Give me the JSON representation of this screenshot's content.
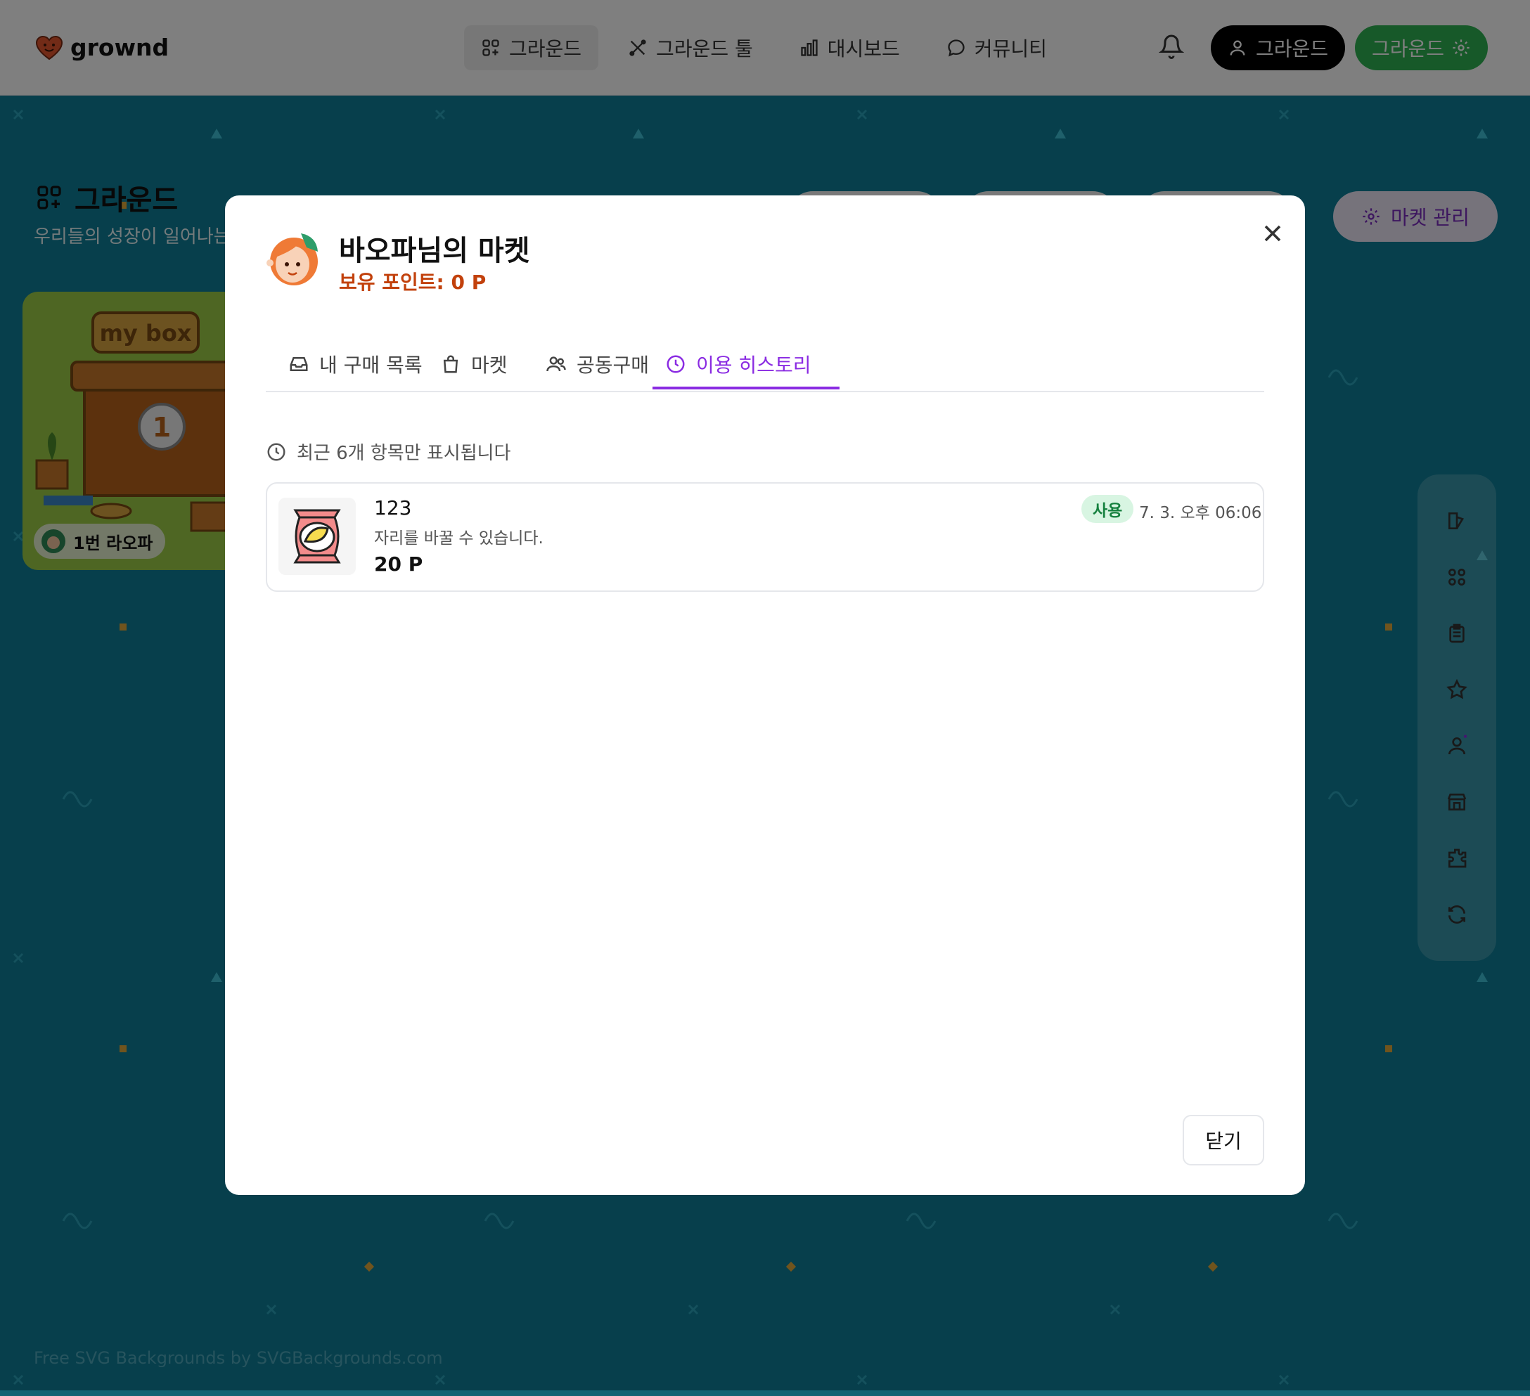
{
  "topbar": {
    "logo": "grownd",
    "nav": [
      {
        "label": "그라운드",
        "icon": "grid-plus-icon",
        "active": true
      },
      {
        "label": "그라운드 툴",
        "icon": "tools-icon",
        "active": false
      },
      {
        "label": "대시보드",
        "icon": "bar-chart-icon",
        "active": false
      },
      {
        "label": "커뮤니티",
        "icon": "chat-bubble-icon",
        "active": false
      }
    ],
    "user_button": "그라운드",
    "ground_button": "그라운드"
  },
  "page": {
    "title": "그라운드",
    "subtitle": "우리들의 성장이 일어나는",
    "market_manage": "마켓 관리",
    "box_card": {
      "sign": "my box",
      "number": "1",
      "badge": "1번 라오파"
    },
    "footer_credit": "Free SVG Backgrounds by SVGBackgrounds.com"
  },
  "modal": {
    "title": "바오파님의 마켓",
    "points": "보유 포인트: 0 P",
    "tabs": [
      {
        "label": "내 구매 목록",
        "icon": "inbox-icon"
      },
      {
        "label": "마켓",
        "icon": "shopping-bag-icon"
      },
      {
        "label": "공동구매",
        "icon": "users-icon"
      },
      {
        "label": "이용 히스토리",
        "icon": "clock-icon"
      }
    ],
    "active_tab": 3,
    "notice": "최근 6개 항목만 표시됩니다",
    "history": [
      {
        "name": "123",
        "description": "자리를 바꿀 수 있습니다.",
        "price": "20 P",
        "badge": "사용",
        "time": "7. 3. 오후 06:06"
      }
    ],
    "close_button": "닫기"
  },
  "colors": {
    "accent_purple": "#8a2be2",
    "points_orange": "#c2410c",
    "use_badge_green": "#16813f",
    "background_teal": "#0e7f98"
  }
}
